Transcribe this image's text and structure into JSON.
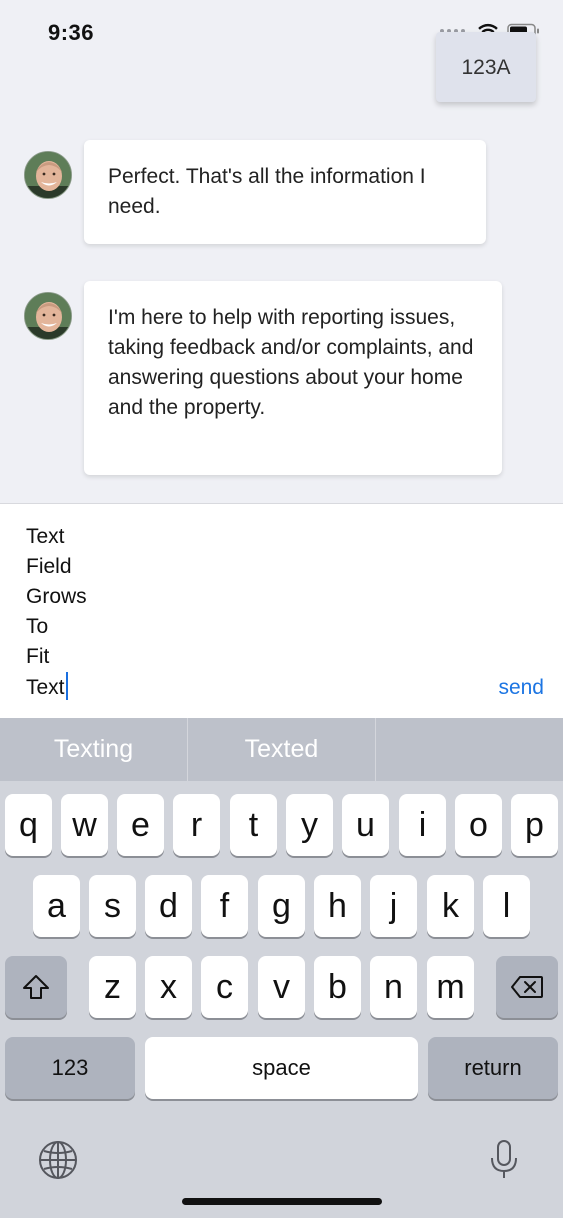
{
  "status_bar": {
    "time": "9:36"
  },
  "unit_badge": "123A",
  "messages": [
    {
      "text": "Perfect.  That's all the information I need."
    },
    {
      "text": "I'm here to help with reporting issues, taking feedback and/or complaints, and answering questions about your home and the property."
    }
  ],
  "composer": {
    "lines": [
      "Text",
      "Field",
      "Grows",
      "To",
      "Fit",
      "Text"
    ],
    "send_label": "send"
  },
  "keyboard": {
    "suggestions": [
      "Texting",
      "Texted",
      ""
    ],
    "row1": [
      "q",
      "w",
      "e",
      "r",
      "t",
      "y",
      "u",
      "i",
      "o",
      "p"
    ],
    "row2": [
      "a",
      "s",
      "d",
      "f",
      "g",
      "h",
      "j",
      "k",
      "l"
    ],
    "row3": [
      "z",
      "x",
      "c",
      "v",
      "b",
      "n",
      "m"
    ],
    "numbers_label": "123",
    "space_label": "space",
    "return_label": "return",
    "icons": {
      "shift": "shift-icon",
      "backspace": "backspace-icon",
      "globe": "globe-icon",
      "mic": "microphone-icon"
    }
  },
  "colors": {
    "accent": "#1c75e3",
    "chat_background": "#eff0f5",
    "keyboard_background": "#d1d4db"
  }
}
